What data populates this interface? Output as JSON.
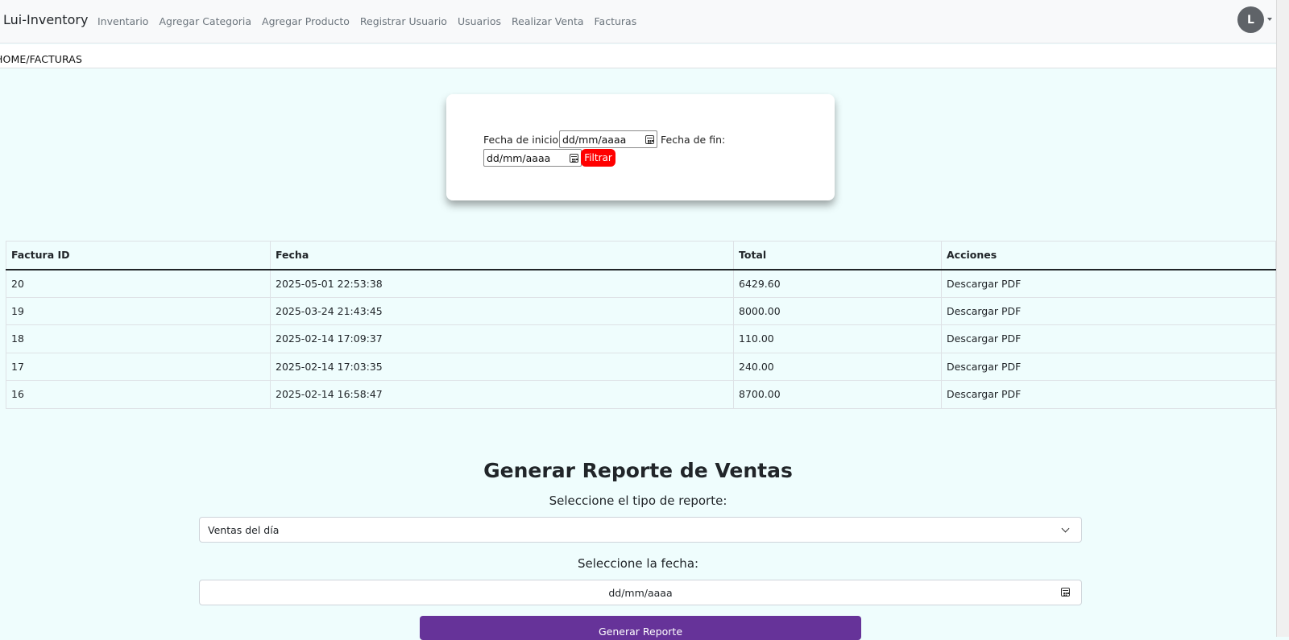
{
  "navbar": {
    "brand": "Lui-Inventory",
    "links": [
      "Inventario",
      "Agregar Categoria",
      "Agregar Producto",
      "Registrar Usuario",
      "Usuarios",
      "Realizar Venta",
      "Facturas"
    ],
    "avatar_letter": "L"
  },
  "breadcrumb": "HOME/FACTURAS",
  "filter": {
    "start_label": "Fecha de inicio:",
    "start_placeholder": "dd/mm/aaaa",
    "end_label": "Fecha de fin:",
    "end_placeholder": "dd/mm/aaaa",
    "button_label": "Filtrar",
    "button_color": "#ff0000"
  },
  "table": {
    "headers": [
      "Factura ID",
      "Fecha",
      "Total",
      "Acciones"
    ],
    "rows": [
      {
        "id": "20",
        "fecha": "2025-05-01 22:53:38",
        "total": "6429.60",
        "accion": "Descargar PDF"
      },
      {
        "id": "19",
        "fecha": "2025-03-24 21:43:45",
        "total": "8000.00",
        "accion": "Descargar PDF"
      },
      {
        "id": "18",
        "fecha": "2025-02-14 17:09:37",
        "total": "110.00",
        "accion": "Descargar PDF"
      },
      {
        "id": "17",
        "fecha": "2025-02-14 17:03:35",
        "total": "240.00",
        "accion": "Descargar PDF"
      },
      {
        "id": "16",
        "fecha": "2025-02-14 16:58:47",
        "total": "8700.00",
        "accion": "Descargar PDF"
      }
    ]
  },
  "report": {
    "title": "Generar Reporte de Ventas",
    "type_label": "Seleccione el tipo de reporte:",
    "type_selected": "Ventas del día",
    "date_label": "Seleccione la fecha:",
    "date_placeholder": "dd/mm/aaaa",
    "button_label": "Generar Reporte",
    "button_color": "#663399"
  }
}
